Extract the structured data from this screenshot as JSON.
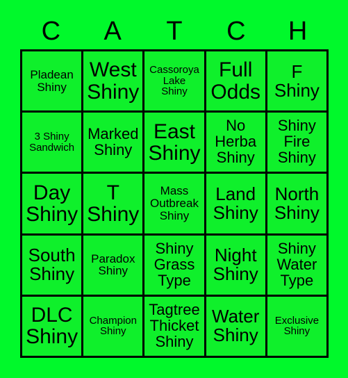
{
  "card": {
    "title_letters": [
      "C",
      "A",
      "T",
      "C",
      "H"
    ],
    "background_color": "#00f92b",
    "cell_color": "#0ff02b",
    "line_color": "#000000",
    "text_color": "#000000",
    "rows": [
      [
        {
          "text": "Pladean\nShiny",
          "size": "sm"
        },
        {
          "text": "West\nShiny",
          "size": "xl"
        },
        {
          "text": "Cassoroya\nLake\nShiny",
          "size": "xs"
        },
        {
          "text": "Full\nOdds",
          "size": "xl"
        },
        {
          "text": "F\nShiny",
          "size": "lg"
        }
      ],
      [
        {
          "text": "3 Shiny\nSandwich",
          "size": "xs"
        },
        {
          "text": "Marked\nShiny",
          "size": "md"
        },
        {
          "text": "East\nShiny",
          "size": "xl"
        },
        {
          "text": "No\nHerba\nShiny",
          "size": "md"
        },
        {
          "text": "Shiny\nFire\nShiny",
          "size": "md"
        }
      ],
      [
        {
          "text": "Day\nShiny",
          "size": "xl"
        },
        {
          "text": "T\nShiny",
          "size": "xl"
        },
        {
          "text": "Mass\nOutbreak\nShiny",
          "size": "sm"
        },
        {
          "text": "Land\nShiny",
          "size": "lg"
        },
        {
          "text": "North\nShiny",
          "size": "lg"
        }
      ],
      [
        {
          "text": "South\nShiny",
          "size": "lg"
        },
        {
          "text": "Paradox\nShiny",
          "size": "sm"
        },
        {
          "text": "Shiny\nGrass\nType",
          "size": "md"
        },
        {
          "text": "Night\nShiny",
          "size": "lg"
        },
        {
          "text": "Shiny\nWater\nType",
          "size": "md"
        }
      ],
      [
        {
          "text": "DLC\nShiny",
          "size": "xl"
        },
        {
          "text": "Champion\nShiny",
          "size": "xs"
        },
        {
          "text": "Tagtree\nThicket\nShiny",
          "size": "md"
        },
        {
          "text": "Water\nShiny",
          "size": "lg"
        },
        {
          "text": "Exclusive\nShiny",
          "size": "xs"
        }
      ]
    ]
  }
}
